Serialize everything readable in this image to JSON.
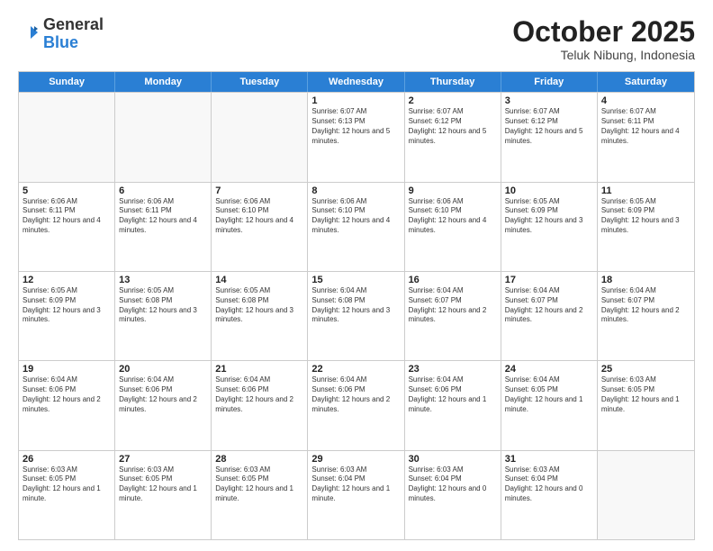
{
  "logo": {
    "general": "General",
    "blue": "Blue"
  },
  "header": {
    "title": "October 2025",
    "subtitle": "Teluk Nibung, Indonesia"
  },
  "days": [
    "Sunday",
    "Monday",
    "Tuesday",
    "Wednesday",
    "Thursday",
    "Friday",
    "Saturday"
  ],
  "weeks": [
    [
      {
        "day": "",
        "empty": true
      },
      {
        "day": "",
        "empty": true
      },
      {
        "day": "",
        "empty": true
      },
      {
        "day": "1",
        "sunrise": "Sunrise: 6:07 AM",
        "sunset": "Sunset: 6:13 PM",
        "daylight": "Daylight: 12 hours and 5 minutes."
      },
      {
        "day": "2",
        "sunrise": "Sunrise: 6:07 AM",
        "sunset": "Sunset: 6:12 PM",
        "daylight": "Daylight: 12 hours and 5 minutes."
      },
      {
        "day": "3",
        "sunrise": "Sunrise: 6:07 AM",
        "sunset": "Sunset: 6:12 PM",
        "daylight": "Daylight: 12 hours and 5 minutes."
      },
      {
        "day": "4",
        "sunrise": "Sunrise: 6:07 AM",
        "sunset": "Sunset: 6:11 PM",
        "daylight": "Daylight: 12 hours and 4 minutes."
      }
    ],
    [
      {
        "day": "5",
        "sunrise": "Sunrise: 6:06 AM",
        "sunset": "Sunset: 6:11 PM",
        "daylight": "Daylight: 12 hours and 4 minutes."
      },
      {
        "day": "6",
        "sunrise": "Sunrise: 6:06 AM",
        "sunset": "Sunset: 6:11 PM",
        "daylight": "Daylight: 12 hours and 4 minutes."
      },
      {
        "day": "7",
        "sunrise": "Sunrise: 6:06 AM",
        "sunset": "Sunset: 6:10 PM",
        "daylight": "Daylight: 12 hours and 4 minutes."
      },
      {
        "day": "8",
        "sunrise": "Sunrise: 6:06 AM",
        "sunset": "Sunset: 6:10 PM",
        "daylight": "Daylight: 12 hours and 4 minutes."
      },
      {
        "day": "9",
        "sunrise": "Sunrise: 6:06 AM",
        "sunset": "Sunset: 6:10 PM",
        "daylight": "Daylight: 12 hours and 4 minutes."
      },
      {
        "day": "10",
        "sunrise": "Sunrise: 6:05 AM",
        "sunset": "Sunset: 6:09 PM",
        "daylight": "Daylight: 12 hours and 3 minutes."
      },
      {
        "day": "11",
        "sunrise": "Sunrise: 6:05 AM",
        "sunset": "Sunset: 6:09 PM",
        "daylight": "Daylight: 12 hours and 3 minutes."
      }
    ],
    [
      {
        "day": "12",
        "sunrise": "Sunrise: 6:05 AM",
        "sunset": "Sunset: 6:09 PM",
        "daylight": "Daylight: 12 hours and 3 minutes."
      },
      {
        "day": "13",
        "sunrise": "Sunrise: 6:05 AM",
        "sunset": "Sunset: 6:08 PM",
        "daylight": "Daylight: 12 hours and 3 minutes."
      },
      {
        "day": "14",
        "sunrise": "Sunrise: 6:05 AM",
        "sunset": "Sunset: 6:08 PM",
        "daylight": "Daylight: 12 hours and 3 minutes."
      },
      {
        "day": "15",
        "sunrise": "Sunrise: 6:04 AM",
        "sunset": "Sunset: 6:08 PM",
        "daylight": "Daylight: 12 hours and 3 minutes."
      },
      {
        "day": "16",
        "sunrise": "Sunrise: 6:04 AM",
        "sunset": "Sunset: 6:07 PM",
        "daylight": "Daylight: 12 hours and 2 minutes."
      },
      {
        "day": "17",
        "sunrise": "Sunrise: 6:04 AM",
        "sunset": "Sunset: 6:07 PM",
        "daylight": "Daylight: 12 hours and 2 minutes."
      },
      {
        "day": "18",
        "sunrise": "Sunrise: 6:04 AM",
        "sunset": "Sunset: 6:07 PM",
        "daylight": "Daylight: 12 hours and 2 minutes."
      }
    ],
    [
      {
        "day": "19",
        "sunrise": "Sunrise: 6:04 AM",
        "sunset": "Sunset: 6:06 PM",
        "daylight": "Daylight: 12 hours and 2 minutes."
      },
      {
        "day": "20",
        "sunrise": "Sunrise: 6:04 AM",
        "sunset": "Sunset: 6:06 PM",
        "daylight": "Daylight: 12 hours and 2 minutes."
      },
      {
        "day": "21",
        "sunrise": "Sunrise: 6:04 AM",
        "sunset": "Sunset: 6:06 PM",
        "daylight": "Daylight: 12 hours and 2 minutes."
      },
      {
        "day": "22",
        "sunrise": "Sunrise: 6:04 AM",
        "sunset": "Sunset: 6:06 PM",
        "daylight": "Daylight: 12 hours and 2 minutes."
      },
      {
        "day": "23",
        "sunrise": "Sunrise: 6:04 AM",
        "sunset": "Sunset: 6:06 PM",
        "daylight": "Daylight: 12 hours and 1 minute."
      },
      {
        "day": "24",
        "sunrise": "Sunrise: 6:04 AM",
        "sunset": "Sunset: 6:05 PM",
        "daylight": "Daylight: 12 hours and 1 minute."
      },
      {
        "day": "25",
        "sunrise": "Sunrise: 6:03 AM",
        "sunset": "Sunset: 6:05 PM",
        "daylight": "Daylight: 12 hours and 1 minute."
      }
    ],
    [
      {
        "day": "26",
        "sunrise": "Sunrise: 6:03 AM",
        "sunset": "Sunset: 6:05 PM",
        "daylight": "Daylight: 12 hours and 1 minute."
      },
      {
        "day": "27",
        "sunrise": "Sunrise: 6:03 AM",
        "sunset": "Sunset: 6:05 PM",
        "daylight": "Daylight: 12 hours and 1 minute."
      },
      {
        "day": "28",
        "sunrise": "Sunrise: 6:03 AM",
        "sunset": "Sunset: 6:05 PM",
        "daylight": "Daylight: 12 hours and 1 minute."
      },
      {
        "day": "29",
        "sunrise": "Sunrise: 6:03 AM",
        "sunset": "Sunset: 6:04 PM",
        "daylight": "Daylight: 12 hours and 1 minute."
      },
      {
        "day": "30",
        "sunrise": "Sunrise: 6:03 AM",
        "sunset": "Sunset: 6:04 PM",
        "daylight": "Daylight: 12 hours and 0 minutes."
      },
      {
        "day": "31",
        "sunrise": "Sunrise: 6:03 AM",
        "sunset": "Sunset: 6:04 PM",
        "daylight": "Daylight: 12 hours and 0 minutes."
      },
      {
        "day": "",
        "empty": true
      }
    ]
  ]
}
